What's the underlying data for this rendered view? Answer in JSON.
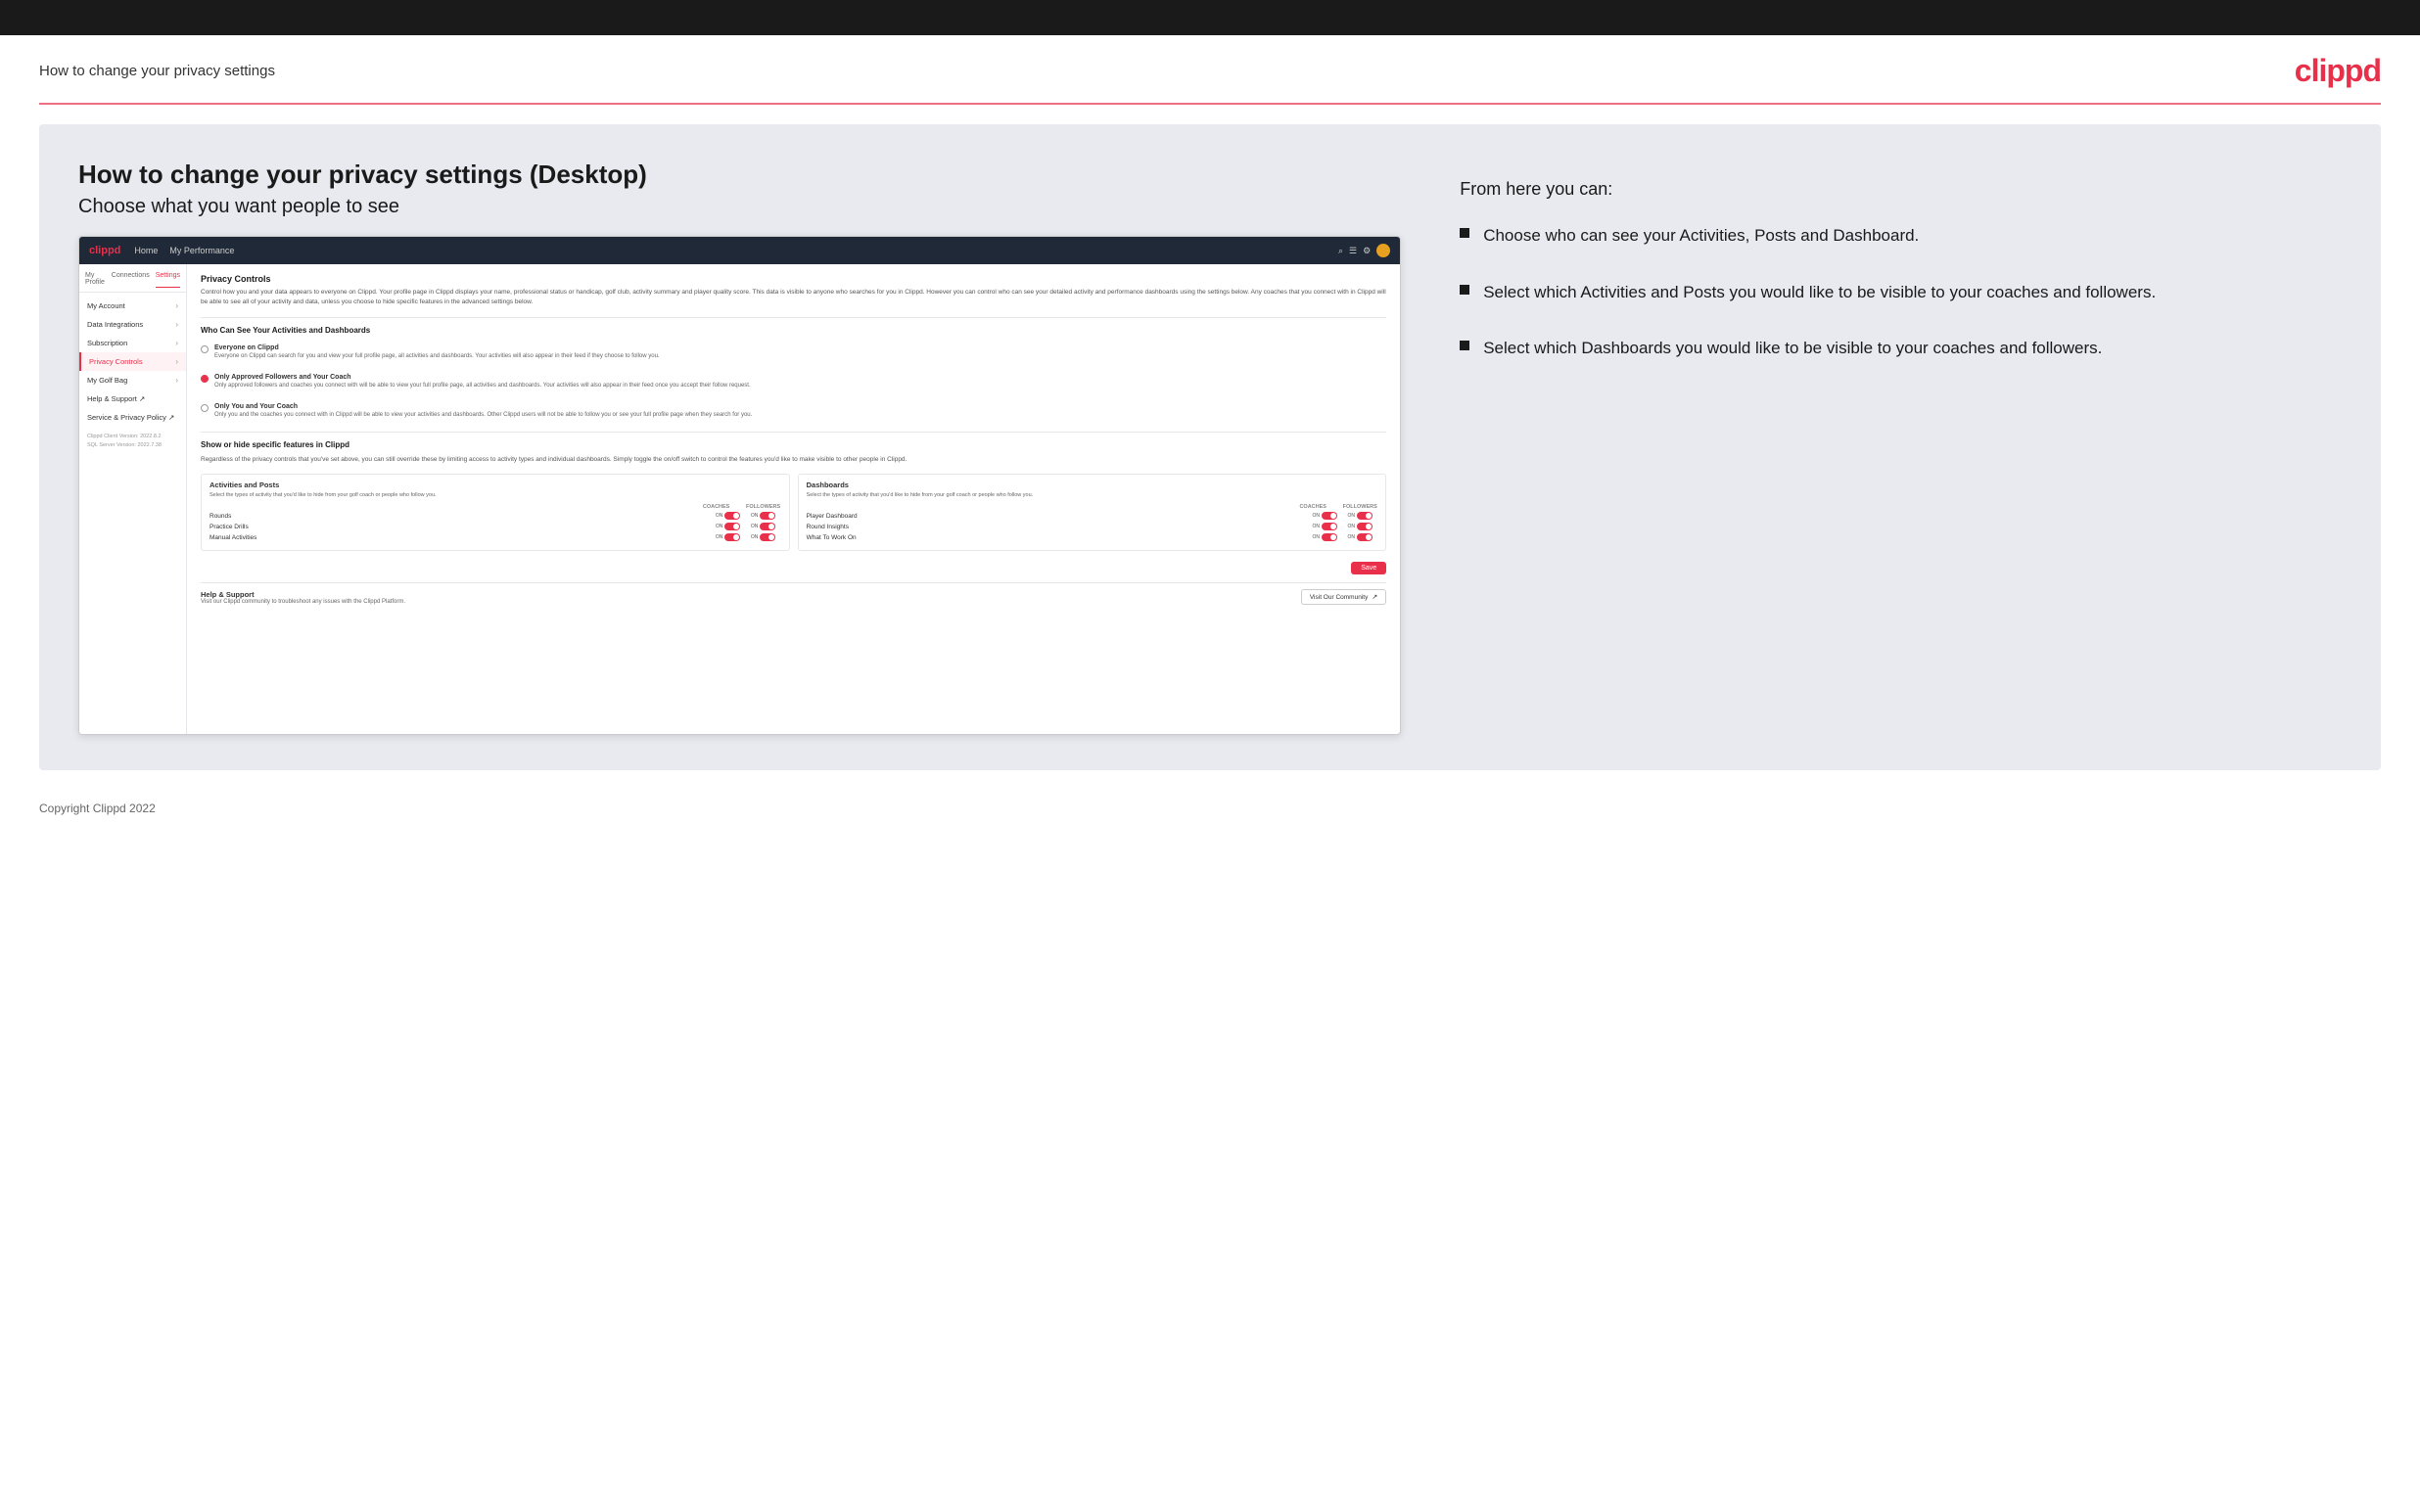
{
  "header": {
    "title": "How to change your privacy settings",
    "logo": "clippd"
  },
  "main": {
    "heading": "How to change your privacy settings (Desktop)",
    "subheading": "Choose what you want people to see"
  },
  "rightPanel": {
    "title": "From here you can:",
    "bullets": [
      "Choose who can see your Activities, Posts and Dashboard.",
      "Select which Activities and Posts you would like to be visible to your coaches and followers.",
      "Select which Dashboards you would like to be visible to your coaches and followers."
    ]
  },
  "mockApp": {
    "navbar": {
      "logo": "clippd",
      "links": [
        "Home",
        "My Performance"
      ]
    },
    "sidebar": {
      "tabs": [
        "My Profile",
        "Connections",
        "Settings"
      ],
      "activeTab": "Settings",
      "items": [
        {
          "label": "My Account",
          "active": false
        },
        {
          "label": "Data Integrations",
          "active": false
        },
        {
          "label": "Subscription",
          "active": false
        },
        {
          "label": "Privacy Controls",
          "active": true
        },
        {
          "label": "My Golf Bag",
          "active": false
        },
        {
          "label": "Help & Support",
          "active": false
        },
        {
          "label": "Service & Privacy Policy",
          "active": false
        }
      ],
      "version": "Clippd Client Version: 2022.8.2\nSQL Server Version: 2022.7.38"
    },
    "privacyControls": {
      "title": "Privacy Controls",
      "description": "Control how you and your data appears to everyone on Clippd. Your profile page in Clippd displays your name, professional status or handicap, golf club, activity summary and player quality score. This data is visible to anyone who searches for you in Clippd. However you can control who can see your detailed activity and performance dashboards using the settings below. Any coaches that you connect with in Clippd will be able to see all of your activity and data, unless you choose to hide specific features in the advanced settings below.",
      "whoCanSeeTitle": "Who Can See Your Activities and Dashboards",
      "radioOptions": [
        {
          "label": "Everyone on Clippd",
          "description": "Everyone on Clippd can search for you and view your full profile page, all activities and dashboards. Your activities will also appear in their feed if they choose to follow you.",
          "selected": false
        },
        {
          "label": "Only Approved Followers and Your Coach",
          "description": "Only approved followers and coaches you connect with will be able to view your full profile page, all activities and dashboards. Your activities will also appear in their feed once you accept their follow request.",
          "selected": true
        },
        {
          "label": "Only You and Your Coach",
          "description": "Only you and the coaches you connect with in Clippd will be able to view your activities and dashboards. Other Clippd users will not be able to follow you or see your full profile page when they search for you.",
          "selected": false
        }
      ],
      "showHideTitle": "Show or hide specific features in Clippd",
      "showHideDesc": "Regardless of the privacy controls that you've set above, you can still override these by limiting access to activity types and individual dashboards. Simply toggle the on/off switch to control the features you'd like to make visible to other people in Clippd.",
      "activitiesCard": {
        "title": "Activities and Posts",
        "desc": "Select the types of activity that you'd like to hide from your golf coach or people who follow you.",
        "columns": [
          "COACHES",
          "FOLLOWERS"
        ],
        "rows": [
          {
            "label": "Rounds",
            "coaches": "ON",
            "followers": "ON"
          },
          {
            "label": "Practice Drills",
            "coaches": "ON",
            "followers": "ON"
          },
          {
            "label": "Manual Activities",
            "coaches": "ON",
            "followers": "ON"
          }
        ]
      },
      "dashboardsCard": {
        "title": "Dashboards",
        "desc": "Select the types of activity that you'd like to hide from your golf coach or people who follow you.",
        "columns": [
          "COACHES",
          "FOLLOWERS"
        ],
        "rows": [
          {
            "label": "Player Dashboard",
            "coaches": "ON",
            "followers": "ON"
          },
          {
            "label": "Round Insights",
            "coaches": "ON",
            "followers": "ON"
          },
          {
            "label": "What To Work On",
            "coaches": "ON",
            "followers": "ON"
          }
        ]
      },
      "saveLabel": "Save"
    },
    "helpSection": {
      "title": "Help & Support",
      "desc": "Visit our Clippd community to troubleshoot any issues with the Clippd Platform.",
      "buttonLabel": "Visit Our Community"
    }
  },
  "footer": {
    "text": "Copyright Clippd 2022"
  }
}
